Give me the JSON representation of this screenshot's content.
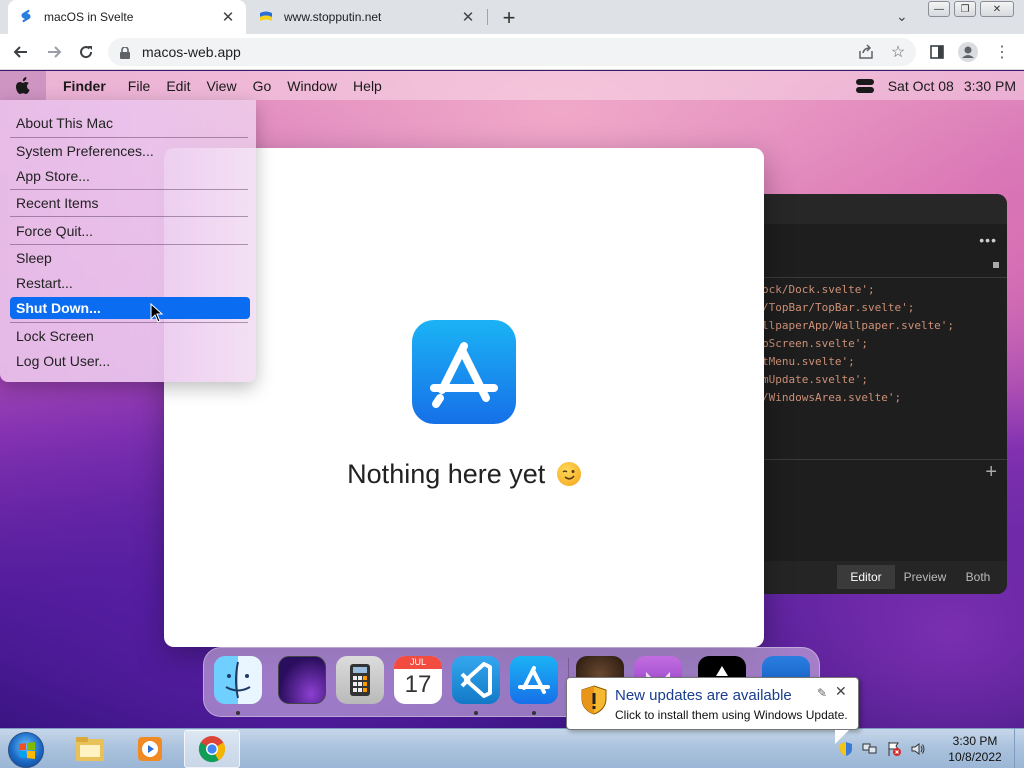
{
  "browser": {
    "tabs": [
      {
        "title": "macOS in Svelte",
        "active": true
      },
      {
        "title": "www.stopputin.net",
        "active": false
      }
    ],
    "address": "macos-web.app",
    "accent": "#1a73e8"
  },
  "mac": {
    "menubar": {
      "app_name": "Finder",
      "items": [
        "File",
        "Edit",
        "View",
        "Go",
        "Window",
        "Help"
      ],
      "date": "Sat Oct 08",
      "time": "3:30 PM"
    },
    "apple_menu": {
      "items": [
        "About This Mac",
        "System Preferences...",
        "App Store...",
        "Recent Items",
        "Force Quit...",
        "Sleep",
        "Restart...",
        "Shut Down...",
        "Lock Screen",
        "Log Out User..."
      ],
      "selected": "Shut Down...",
      "selection_color": "#0a6cf0"
    },
    "app_store_window": {
      "message": "Nothing here yet"
    },
    "editor_window": {
      "code_lines": [
        "ock/Dock.svelte';",
        "/TopBar/TopBar.svelte';",
        "llpaperApp/Wallpaper.svelte';",
        "pScreen.svelte';",
        "tMenu.svelte';",
        "mUpdate.svelte';",
        "/WindowsArea.svelte';"
      ],
      "tabs": [
        "Editor",
        "Preview",
        "Both"
      ],
      "active_tab": "Editor"
    },
    "dock": {
      "apps": [
        "finder-icon",
        "wallpapers-icon",
        "calculator-icon",
        "calendar-icon",
        "vscode-icon",
        "appstore-icon",
        "purus-twitter-icon",
        "cat-icon",
        "apple-tv-icon",
        "blue-app-icon"
      ],
      "calendar_month": "JUL",
      "calendar_day": "17"
    }
  },
  "windows": {
    "taskbar": {
      "pinned": [
        "explorer-icon",
        "media-player-icon",
        "chrome-icon"
      ],
      "clock_time": "3:30 PM",
      "clock_date": "10/8/2022"
    },
    "notification": {
      "title": "New updates are available",
      "text": "Click to install them using Windows Update."
    }
  }
}
